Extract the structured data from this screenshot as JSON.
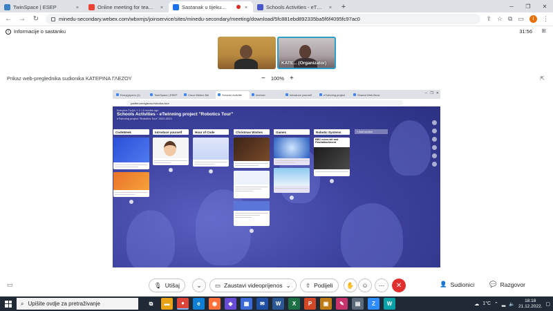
{
  "browser": {
    "tabs": [
      {
        "label": "TwinSpace | ESEP",
        "icon_color": "#3b82c4",
        "active": false
      },
      {
        "label": "Online meeting for teachers tod",
        "icon_color": "#ea4335",
        "active": false
      },
      {
        "label": "Sastanak u tijeku...",
        "icon_color": "#1a73e8",
        "active": true
      },
      {
        "label": "Schools Activities - eTwinning pr",
        "icon_color": "#4a57c9",
        "active": false
      }
    ],
    "url": "minedu-secondary.webex.com/wbxmjs/joinservice/sites/minedu-secondary/meeting/download/5fc881ebd892335ba5f6f4095fc97ac0",
    "profile_initial": "I"
  },
  "meeting": {
    "info_label": "Informacije o sastanku",
    "timer": "31:56",
    "participant_label": "KATE... (Organizator)",
    "share_prefix": "Prikaz web-preglednika sudionika ",
    "share_name": "ΚΑΤΕΡΙΝΑ ΓΛΕΖΟΥ",
    "zoom": "100%",
    "zoom_out": "−",
    "zoom_in": "+"
  },
  "shared": {
    "tabs": [
      "Εισερχόμενα (1)",
      "TwinSpace | ESEP",
      "Cisco Webex Me",
      "Schools Activitie",
      "Ιστότοπ",
      "Introduce yourself",
      "eTwinning project",
      "Shared Web Brow"
    ],
    "url": "padlet.com/glezou/robotics-tour",
    "crumb": "Κατερίνα Γλεζού + 2 • 5 months ago",
    "title": "Schools Activities - eTwinning project \"Robotics Tour\"",
    "subtitle": "eTwinning project \"Robotics Tour\" 2022-2023",
    "columns": [
      {
        "title": "CodeWeek",
        "accent": "#3b5bd9"
      },
      {
        "title": "Introduce yourself",
        "accent": "#f0e0d0"
      },
      {
        "title": "Hour of Code",
        "accent": "#e8eefb"
      },
      {
        "title": "Christmas Wishes",
        "accent": "#5a3a2a"
      },
      {
        "title": "Games",
        "accent": "#3b7bd9"
      },
      {
        "title": "Robotic Systems",
        "accent": "#e8e8e8"
      }
    ],
    "card_heading": "BBC micro:bit and Flashattachment",
    "add_section": "+ Add section"
  },
  "controls": {
    "mute": "Utišaj",
    "video": "Zaustavi videoprijenos",
    "share": "Podijeli",
    "participants": "Sudionici",
    "chat": "Razgovor"
  },
  "taskbar": {
    "search_placeholder": "Upišite ovdje za pretraživanje",
    "weather": "1°C",
    "time": "18:18",
    "date": "21.12.2022.",
    "apps": [
      {
        "name": "task-view",
        "label": "⧉",
        "color": "#1f2a36"
      },
      {
        "name": "file-explorer",
        "label": "▬",
        "color": "#e8a317"
      },
      {
        "name": "chrome",
        "label": "●",
        "color": "#db4437"
      },
      {
        "name": "edge",
        "label": "e",
        "color": "#0f7fd6"
      },
      {
        "name": "firefox",
        "label": "◉",
        "color": "#ff7139"
      },
      {
        "name": "drop",
        "label": "◆",
        "color": "#6a4bd6"
      },
      {
        "name": "store",
        "label": "▦",
        "color": "#3b6ad9"
      },
      {
        "name": "mail",
        "label": "✉",
        "color": "#1f4fa3"
      },
      {
        "name": "word",
        "label": "W",
        "color": "#2b5797"
      },
      {
        "name": "excel",
        "label": "X",
        "color": "#1d7044"
      },
      {
        "name": "powerpoint",
        "label": "P",
        "color": "#d24726"
      },
      {
        "name": "photos",
        "label": "▣",
        "color": "#c07b17"
      },
      {
        "name": "paint",
        "label": "✎",
        "color": "#c9336b"
      },
      {
        "name": "media",
        "label": "▤",
        "color": "#5b6b7b"
      },
      {
        "name": "zoom",
        "label": "Z",
        "color": "#2d8cff"
      },
      {
        "name": "webex",
        "label": "W",
        "color": "#0aa0a8"
      }
    ]
  }
}
